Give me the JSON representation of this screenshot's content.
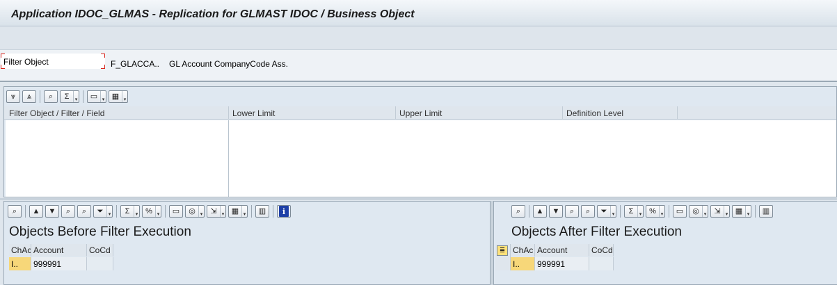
{
  "window": {
    "title": "Application IDOC_GLMAS - Replication for GLMAST IDOC / Business Object"
  },
  "filter": {
    "label": "Filter Object",
    "code": "F_GLACCA..",
    "description": "GL Account CompanyCode Ass."
  },
  "top_grid": {
    "toolbar_icons": [
      "expand-all-icon",
      "collapse-all-icon",
      "find-icon",
      "sum-icon",
      "print-icon",
      "layout-icon"
    ],
    "columns": [
      "Filter Object / Filter / Field",
      "Lower Limit",
      "Upper Limit",
      "Definition Level"
    ]
  },
  "before": {
    "title": "Objects Before Filter Execution",
    "columns": [
      "ChAc",
      "Account",
      "CoCd"
    ],
    "rows": [
      [
        "I..",
        "999991",
        ""
      ]
    ]
  },
  "after": {
    "title": "Objects After Filter Execution",
    "columns": [
      "ChAc",
      "Account",
      "CoCd"
    ],
    "rows": [
      [
        "I..",
        "999991",
        ""
      ]
    ]
  },
  "icons": {
    "info": "i"
  }
}
